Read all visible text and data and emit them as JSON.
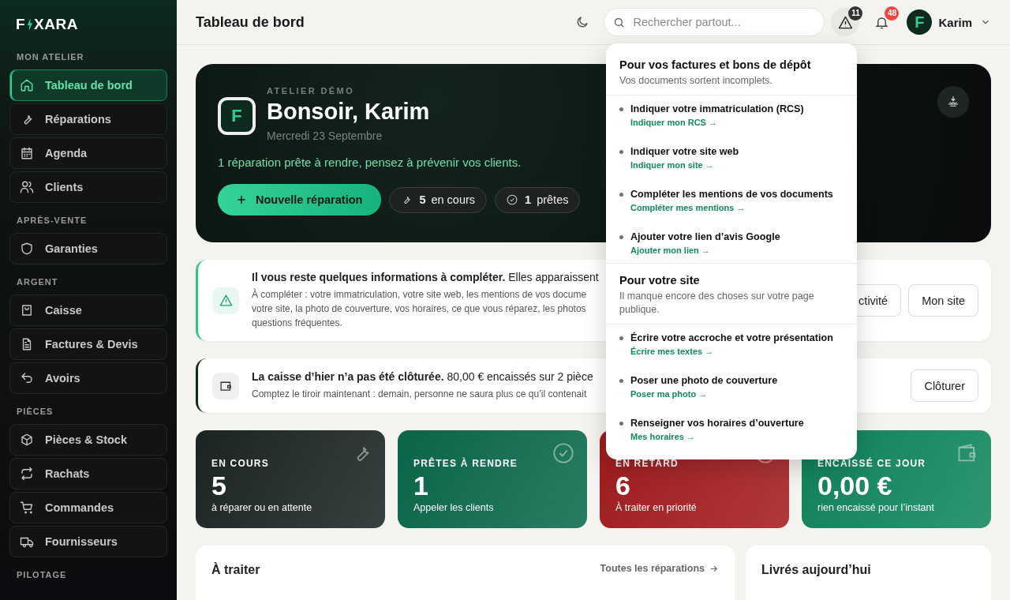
{
  "sidebar": {
    "logo": {
      "before": "F",
      "after": "XARA"
    },
    "sections": [
      {
        "title": "MON ATELIER",
        "items": [
          {
            "label": "Tableau de bord",
            "selected": true
          },
          {
            "label": "Réparations",
            "selected": false
          },
          {
            "label": "Agenda",
            "selected": false
          },
          {
            "label": "Clients",
            "selected": false
          }
        ]
      },
      {
        "title": "APRÈS-VENTE",
        "items": [
          {
            "label": "Garanties",
            "selected": false
          }
        ]
      },
      {
        "title": "ARGENT",
        "items": [
          {
            "label": "Caisse",
            "selected": false
          },
          {
            "label": "Factures & Devis",
            "selected": false
          },
          {
            "label": "Avoirs",
            "selected": false
          }
        ]
      },
      {
        "title": "PIÈCES",
        "items": [
          {
            "label": "Pièces & Stock",
            "selected": false
          },
          {
            "label": "Rachats",
            "selected": false
          },
          {
            "label": "Commandes",
            "selected": false
          },
          {
            "label": "Fournisseurs",
            "selected": false
          }
        ]
      },
      {
        "title": "PILOTAGE"
      }
    ]
  },
  "topbar": {
    "title": "Tableau de bord",
    "search": {
      "placeholder": "Rechercher partout..."
    },
    "warnings_badge": "11",
    "notifications_badge": "48",
    "user": {
      "avatar": "F",
      "name": "Karim"
    }
  },
  "hero": {
    "eyebrow": "ATELIER DÉMO",
    "logo": "F",
    "greeting": "Bonsoir, Karim",
    "date": "Mercredi 23 Septembre",
    "message": "1 réparation prête à rendre, pensez à prévenir vos clients.",
    "primary_button": "Nouvelle réparation",
    "pills": [
      {
        "count": "5",
        "label": "en cours"
      },
      {
        "count": "1",
        "label": "prêtes"
      }
    ]
  },
  "alerts": [
    {
      "kind": "info",
      "title": "Il vous reste quelques informations à compléter.",
      "title_rest": "Elles apparaissent",
      "lines": [
        "À compléter : votre immatriculation, votre site web, les mentions de vos docume",
        "votre site, la photo de couverture, vos horaires, ce que vous réparez, les photos",
        "questions fréquentes."
      ],
      "buttons": [
        "ctivité",
        "Mon site"
      ]
    },
    {
      "kind": "cash",
      "title": "La caisse d’hier n’a pas été clôturée.",
      "title_rest": "80,00 € encaissés sur 2 pièce",
      "lines": [
        "Comptez le tiroir maintenant : demain, personne ne saura plus ce qu’il contenait"
      ],
      "buttons": [
        "Clôturer"
      ]
    }
  ],
  "stats": [
    {
      "label": "EN COURS",
      "value": "5",
      "caption": "à réparer ou en attente",
      "color": "#1c2624"
    },
    {
      "label": "PRÊTES À RENDRE",
      "value": "1",
      "caption": "Appeler les clients",
      "color": "#0b6a4c"
    },
    {
      "label": "EN RETARD",
      "value": "6",
      "caption": "À traiter en priorité",
      "color": "#a51d1f"
    },
    {
      "label": "ENCAISSÉ CE JOUR",
      "value": "0,00 €",
      "caption": "rien encaissé pour l’instant",
      "color": "#11875f"
    }
  ],
  "panels": [
    {
      "title": "À traiter",
      "link": "Toutes les réparations"
    },
    {
      "title": "Livrés aujourd’hui"
    }
  ],
  "dropdown": {
    "sections": [
      {
        "title": "Pour vos factures et bons de dépôt",
        "subtitle": "Vos documents sortent incomplets.",
        "items": [
          {
            "title": "Indiquer votre immatriculation (RCS)",
            "link": "Indiquer mon RCS →"
          },
          {
            "title": "Indiquer votre site web",
            "link": "Indiquer mon site →"
          },
          {
            "title": "Compléter les mentions de vos documents",
            "link": "Compléter mes mentions →"
          },
          {
            "title": "Ajouter votre lien d’avis Google",
            "link": "Ajouter mon lien →"
          }
        ]
      },
      {
        "title": "Pour votre site",
        "subtitle": "Il manque encore des choses sur votre page publique.",
        "items": [
          {
            "title": "Écrire votre accroche et votre présentation",
            "link": "Écrire mes textes →"
          },
          {
            "title": "Poser une photo de couverture",
            "link": "Poser ma photo →"
          },
          {
            "title": "Renseigner vos horaires d’ouverture",
            "link": "Mes horaires →"
          }
        ]
      }
    ]
  }
}
